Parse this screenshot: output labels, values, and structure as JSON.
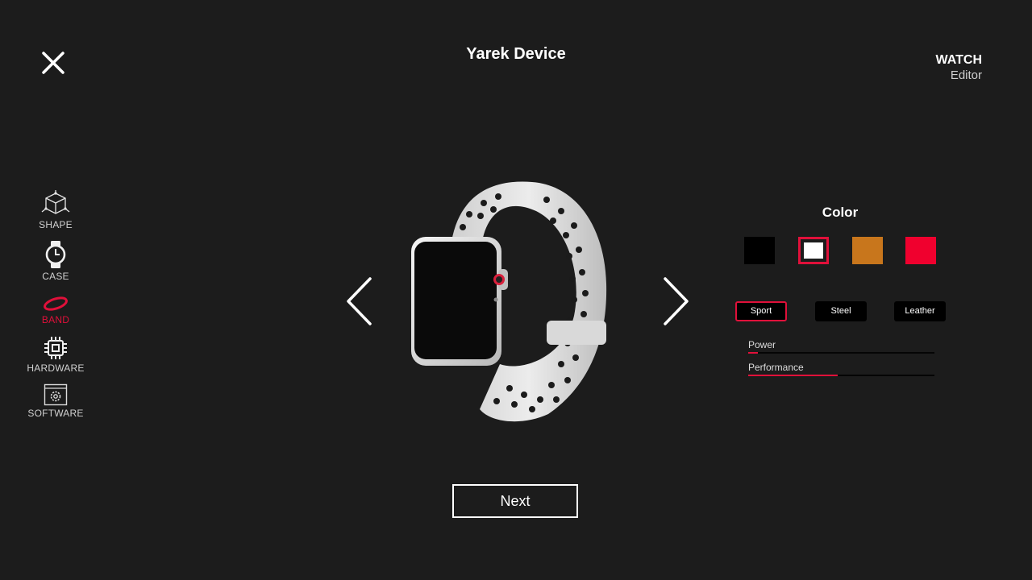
{
  "header": {
    "title": "Yarek Device",
    "brand_main": "WATCH",
    "brand_sub": "Editor"
  },
  "sidebar": {
    "items": [
      {
        "label": "SHAPE",
        "icon": "cube-icon"
      },
      {
        "label": "CASE",
        "icon": "watch-case-icon"
      },
      {
        "label": "BAND",
        "icon": "band-loop-icon",
        "active": true
      },
      {
        "label": "HARDWARE",
        "icon": "chip-icon"
      },
      {
        "label": "SOFTWARE",
        "icon": "software-gear-icon"
      }
    ]
  },
  "preview": {
    "prev_icon": "chevron-left-icon",
    "next_icon": "chevron-right-icon",
    "image": "smartwatch-sport-band"
  },
  "actions": {
    "next_label": "Next"
  },
  "color_panel": {
    "title": "Color",
    "swatches": [
      {
        "name": "black",
        "hex": "#000000"
      },
      {
        "name": "white",
        "hex": "#ffffff",
        "selected": true
      },
      {
        "name": "orange",
        "hex": "#c8761c"
      },
      {
        "name": "red",
        "hex": "#f0002e"
      }
    ],
    "selection_color": "#e0103a"
  },
  "materials": [
    {
      "label": "Sport",
      "selected": true
    },
    {
      "label": "Steel"
    },
    {
      "label": "Leather"
    }
  ],
  "stats": [
    {
      "label": "Power",
      "value": 0.05
    },
    {
      "label": "Performance",
      "value": 0.48
    }
  ],
  "colors": {
    "accent": "#e0103a",
    "background": "#1c1c1c"
  }
}
